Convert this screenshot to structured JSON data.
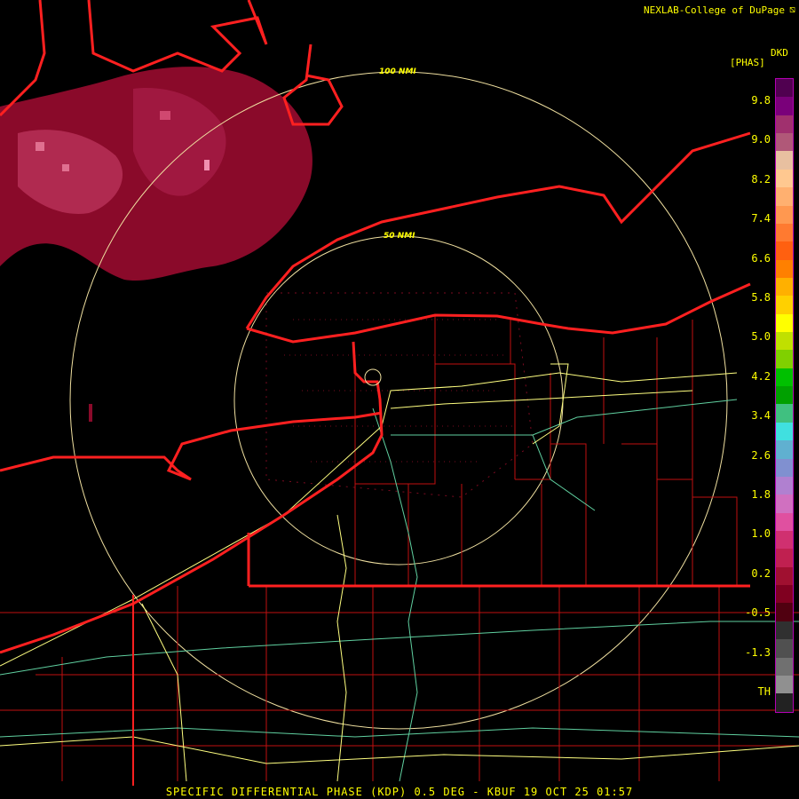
{
  "header": {
    "credit": "NEXLAB-College of DuPage"
  },
  "legend": {
    "unit": "DKD",
    "product_label": "[PHAS]",
    "ticks": [
      "9.8",
      "9.0",
      "8.2",
      "7.4",
      "6.6",
      "5.8",
      "5.0",
      "4.2",
      "3.4",
      "2.6",
      "1.8",
      "1.0",
      "0.2",
      "-0.5",
      "-1.3",
      "TH"
    ],
    "colors": [
      "#500050",
      "#7a007a",
      "#a0306e",
      "#b05878",
      "#e8c0a0",
      "#ffc890",
      "#ffb070",
      "#ff9850",
      "#ff7a30",
      "#ff6010",
      "#ff8000",
      "#ffb000",
      "#ffd000",
      "#ffff00",
      "#c0e000",
      "#80d000",
      "#00c000",
      "#00a000",
      "#40c080",
      "#40e0e0",
      "#60b0d0",
      "#8090d0",
      "#b080d0",
      "#d070c0",
      "#e050a0",
      "#d03070",
      "#c02050",
      "#a01030",
      "#800020",
      "#500010",
      "#303030",
      "#505050",
      "#707070",
      "#909090",
      "#222222"
    ]
  },
  "rings": {
    "inner": "50 NMI",
    "outer": "100 NMI"
  },
  "footer": {
    "caption": "SPECIFIC DIFFERENTIAL PHASE (KDP) 0.5 DEG - KBUF 19 OCT 25 01:57"
  },
  "colors": {
    "shoreline": "#ff2020",
    "county": "#d01010",
    "highway": "#ffff80",
    "road": "#60d0a0",
    "ring": "#f0e0a0",
    "echo": "#a01030"
  }
}
